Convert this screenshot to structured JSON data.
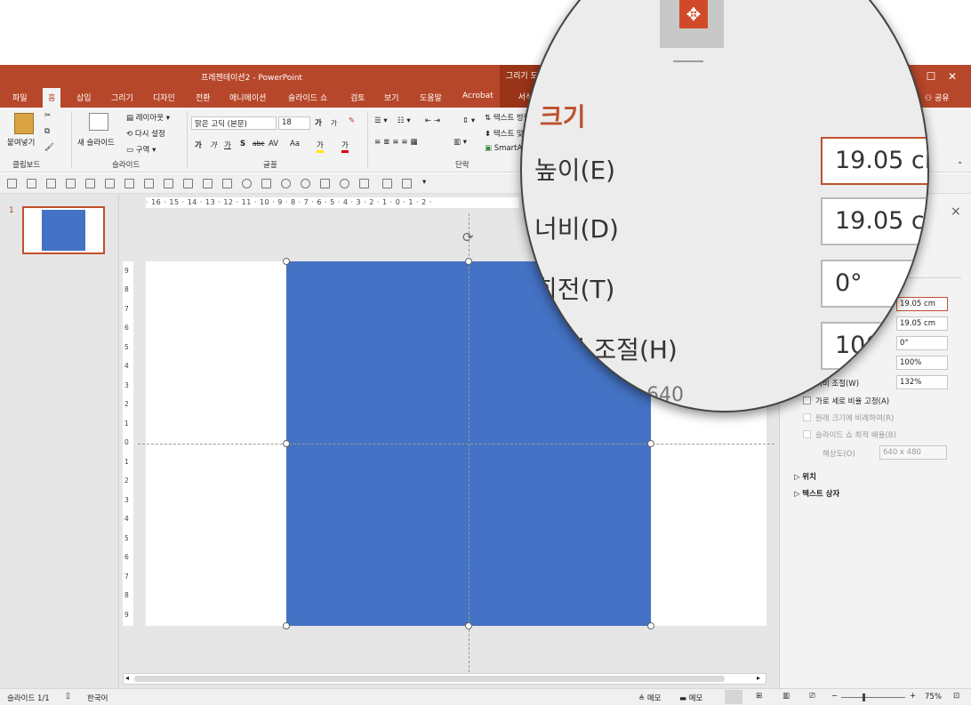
{
  "window": {
    "title": "프레젠테이션2  -  PowerPoint",
    "context_group": "그리기 도구",
    "share_label": "공유"
  },
  "tabs": [
    "파일",
    "홈",
    "삽입",
    "그리기",
    "디자인",
    "전환",
    "애니메이션",
    "슬라이드 쇼",
    "검토",
    "보기",
    "도움말",
    "Acrobat"
  ],
  "context_tab": "서식",
  "ribbon": {
    "clipboard": {
      "paste_label": "붙여넣기",
      "group_label": "클립보드"
    },
    "slides": {
      "new_slide": "새 슬라이드",
      "layout": "레이아웃",
      "reset": "다시 설정",
      "section": "구역",
      "group_label": "슬라이드"
    },
    "font": {
      "font_name": "맑은 고딕 (본문)",
      "font_size": "18",
      "bold": "가",
      "italic": "가",
      "underline": "가",
      "shadow": "S",
      "strike": "abc",
      "spacing": "AV",
      "case": "Aa",
      "highlight": "가",
      "color": "가",
      "grow": "가",
      "shrink": "가",
      "group_label": "글꼴"
    },
    "paragraph": {
      "text_dir": "텍스트 방향",
      "align_text": "텍스트 맞춤",
      "smartart": "SmartArt",
      "group_label": "단락"
    }
  },
  "ruler": {
    "h_ticks": "· 16 · 15 · 14 · 13 · 12 · 11 · 10 · 9 · 8 · 7 · 6 · 5 · 4 · 3 · 2 · 1 · 0 · 1 · 2 ·",
    "v_ticks": [
      "9",
      "8",
      "7",
      "6",
      "5",
      "4",
      "3",
      "2",
      "1",
      "0",
      "1",
      "2",
      "3",
      "4",
      "5",
      "6",
      "7",
      "8",
      "9"
    ]
  },
  "thumbnail": {
    "number": "1"
  },
  "format_pane": {
    "close": "×",
    "height_value": "19.05 cm",
    "width_value": "19.05 cm",
    "rotation_value": "0°",
    "scale_h_value": "100%",
    "scale_w_label": "너비 조절(W)",
    "scale_w_value": "132%",
    "lock_aspect": "가로 세로 비율 고정(A)",
    "relative_original": "원래 크기에 비례하여(R)",
    "best_scale": "슬라이드 쇼 최적 배율(B)",
    "resolution_label": "해상도(O)",
    "resolution_value": "640 x 480",
    "position": "위치",
    "textbox": "텍스트 상자"
  },
  "magnifier": {
    "section_title": "크기",
    "height_label": "높이(E)",
    "width_label": "너비(D)",
    "rotation_label": "회전(T)",
    "scale_label": "높이 조절(H)",
    "height_value": "19.05 cm",
    "width_value": "19.05 cm",
    "rotation_value": "0°",
    "scale_value": "100%",
    "partial_text": "640"
  },
  "status": {
    "slide_info": "슬라이드 1/1",
    "language": "한국어",
    "notes": "메모",
    "comments": "메모",
    "zoom": "75%",
    "minus": "−",
    "plus": "+"
  },
  "colors": {
    "accent": "#b7472a",
    "context": "#9a3418",
    "shape": "#4472c4"
  }
}
